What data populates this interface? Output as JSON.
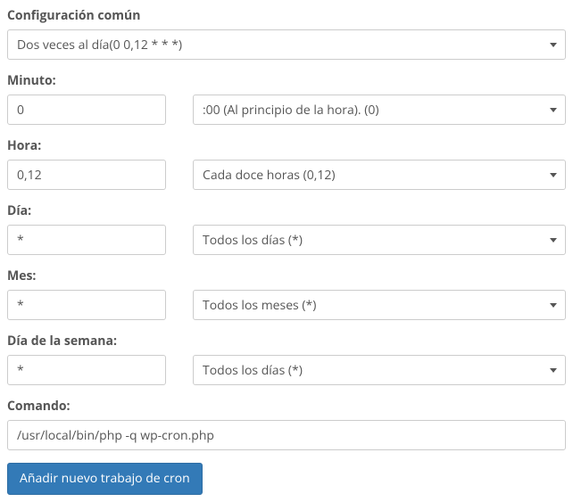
{
  "common": {
    "title": "Configuración común",
    "selected": "Dos veces al día(0 0,12 * * *)"
  },
  "minute": {
    "label": "Minuto:",
    "value": "0",
    "option": ":00 (Al principio de la hora). (0)"
  },
  "hour": {
    "label": "Hora:",
    "value": "0,12",
    "option": "Cada doce horas (0,12)"
  },
  "day": {
    "label": "Día:",
    "value": "*",
    "option": "Todos los días (*)"
  },
  "month": {
    "label": "Mes:",
    "value": "*",
    "option": "Todos los meses (*)"
  },
  "weekday": {
    "label": "Día de la semana:",
    "value": "*",
    "option": "Todos los días (*)"
  },
  "command": {
    "label": "Comando:",
    "value": "/usr/local/bin/php -q wp-cron.php"
  },
  "submit": {
    "label": "Añadir nuevo trabajo de cron"
  }
}
